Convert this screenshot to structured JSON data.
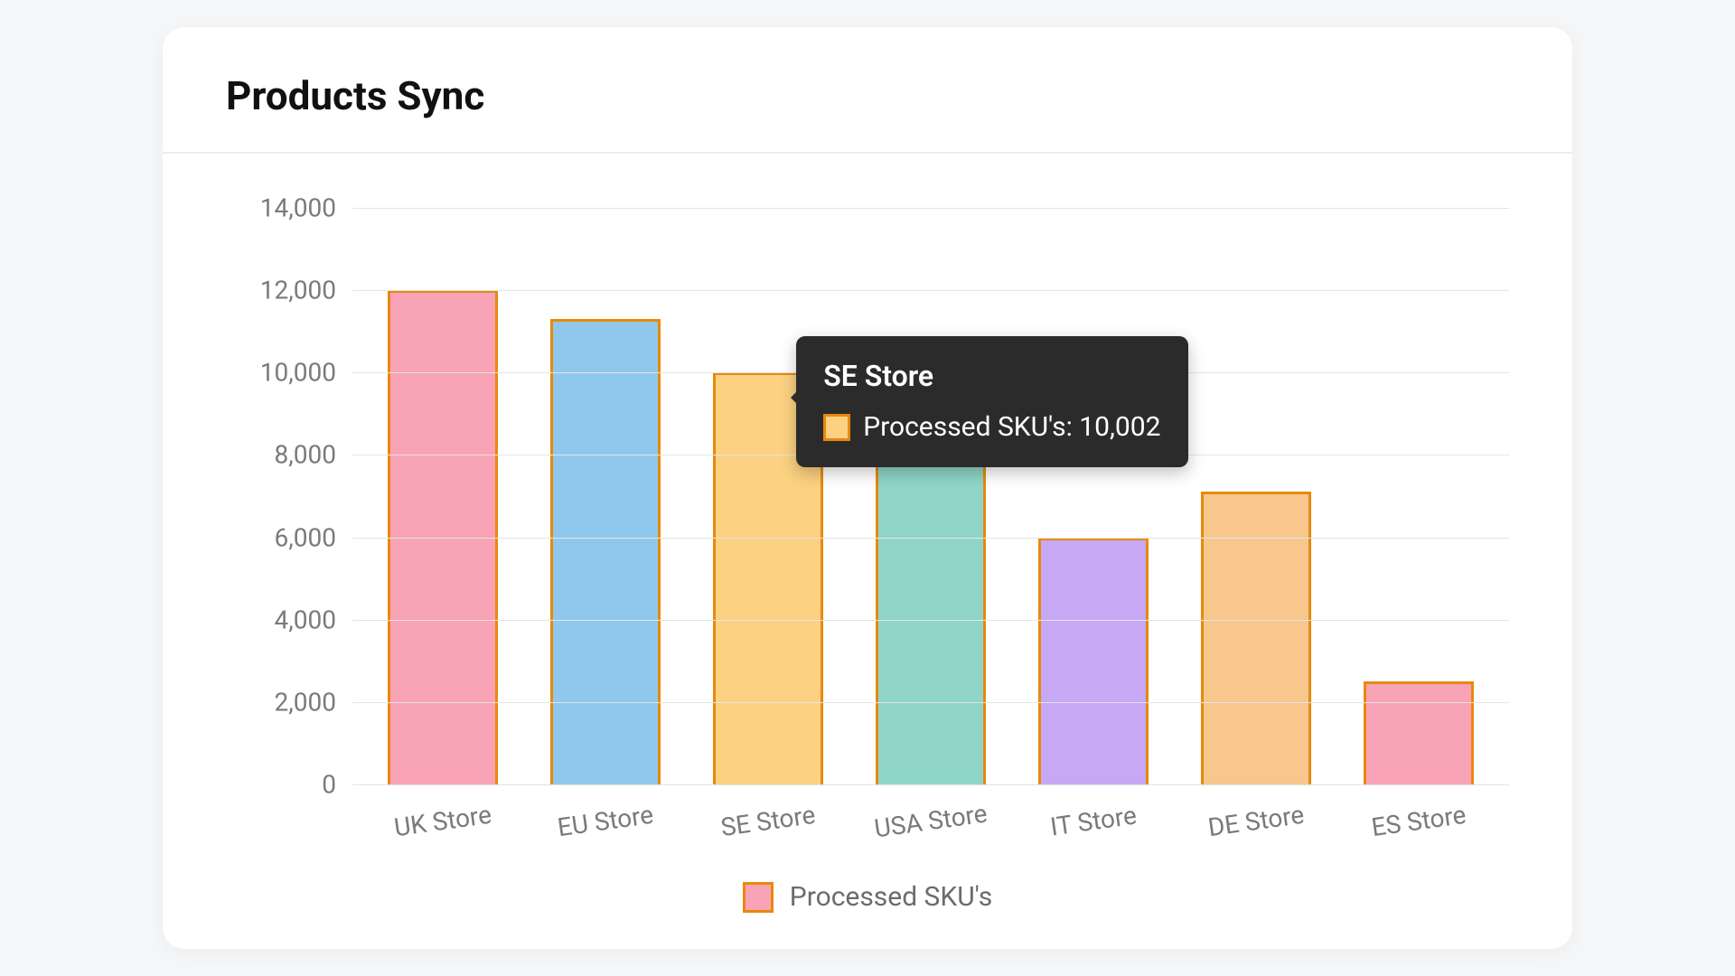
{
  "chart_data": {
    "type": "bar",
    "title": "Products Sync",
    "xlabel": "",
    "ylabel": "",
    "ylim": [
      0,
      14000
    ],
    "y_ticks": [
      0,
      2000,
      4000,
      6000,
      8000,
      10000,
      12000,
      14000
    ],
    "y_tick_labels": [
      "0",
      "2,000",
      "4,000",
      "6,000",
      "8,000",
      "10,000",
      "12,000",
      "14,000"
    ],
    "categories": [
      "UK Store",
      "EU Store",
      "SE Store",
      "USA Store",
      "IT Store",
      "DE Store",
      "ES Store"
    ],
    "series": [
      {
        "name": "Processed SKU's",
        "values": [
          12000,
          11300,
          10002,
          9600,
          6000,
          7100,
          2500
        ],
        "colors": [
          "#f8a3b6",
          "#8fc8ec",
          "#fcd181",
          "#8fd6c8",
          "#c6a8f5",
          "#f7c78e",
          "#f8a3b6"
        ]
      }
    ],
    "bar_border_color": "#e8890c",
    "legend": {
      "label": "Processed SKU's",
      "swatch_color": "#f8a3b6"
    },
    "tooltip": {
      "visible": true,
      "category_index": 2,
      "title": "SE Store",
      "series_label": "Processed SKU's",
      "value_formatted": "10,002",
      "swatch_color": "#fcd181"
    }
  }
}
